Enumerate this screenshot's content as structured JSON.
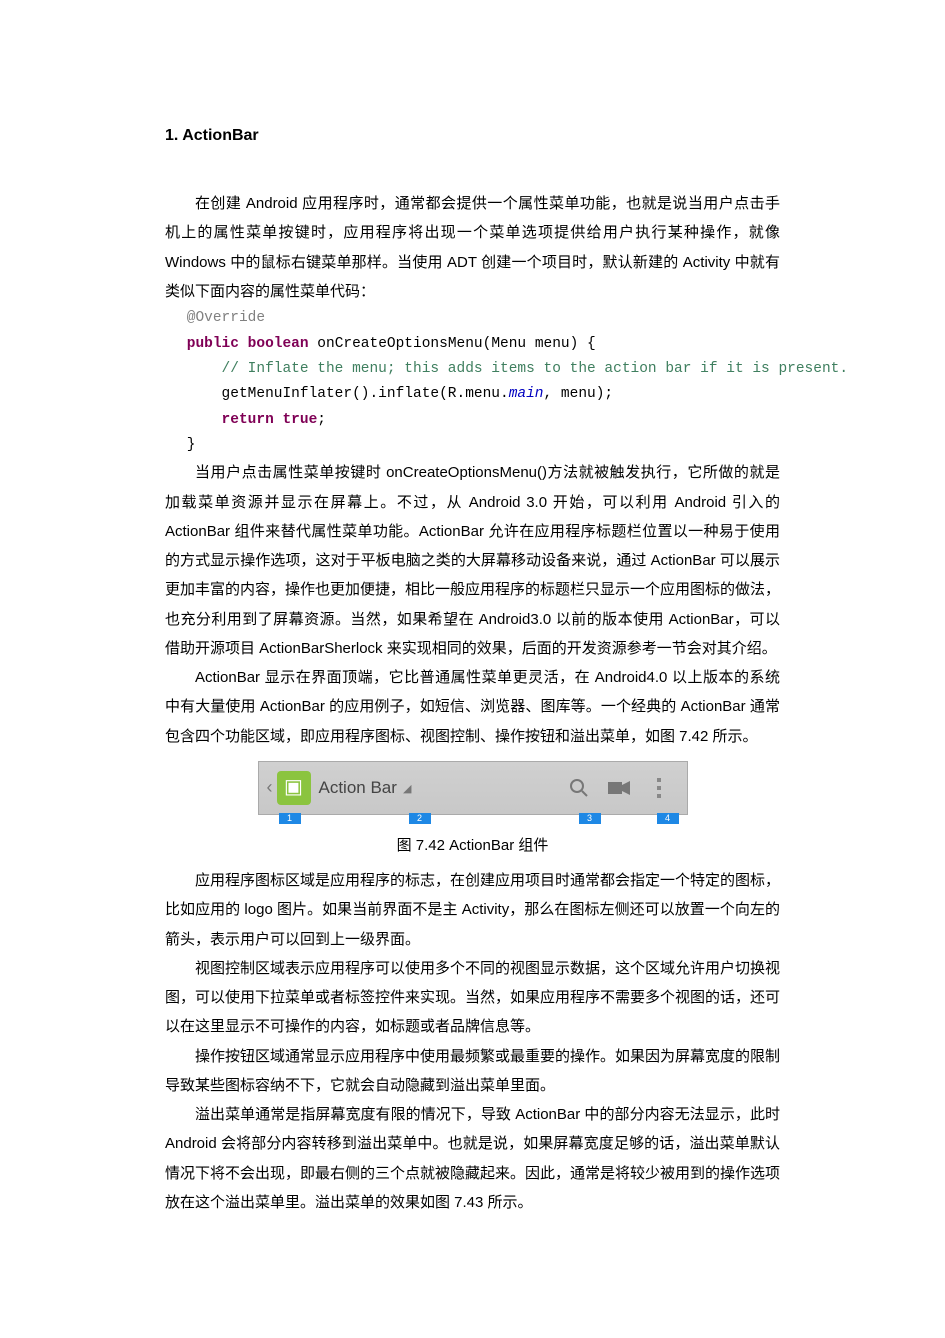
{
  "heading": "1. ActionBar",
  "para1": "在创建 Android 应用程序时，通常都会提供一个属性菜单功能，也就是说当用户点击手机上的属性菜单按键时，应用程序将出现一个菜单选项提供给用户执行某种操作，就像 Windows 中的鼠标右键菜单那样。当使用 ADT 创建一个项目时，默认新建的 Activity 中就有类似下面内容的属性菜单代码：",
  "code": {
    "l1a": "@Override",
    "l2a": "public",
    "l2b": " ",
    "l2c": "boolean",
    "l2d": " onCreateOptionsMenu(Menu menu) {",
    "l3": "    // Inflate the menu; this adds items to the action bar if it is present.",
    "l4a": "    getMenuInflater().inflate(R.menu.",
    "l4b": "main",
    "l4c": ", menu);",
    "l5": "    return true",
    "l5b": ";",
    "l6": "}"
  },
  "para2": "当用户点击属性菜单按键时 onCreateOptionsMenu()方法就被触发执行，它所做的就是加载菜单资源并显示在屏幕上。不过，从 Android 3.0 开始，可以利用 Android 引入的 ActionBar 组件来替代属性菜单功能。ActionBar  允许在应用程序标题栏位置以一种易于使用的方式显示操作选项，这对于平板电脑之类的大屏幕移动设备来说，通过 ActionBar 可以展示更加丰富的内容，操作也更加便捷，相比一般应用程序的标题栏只显示一个应用图标的做法，也充分利用到了屏幕资源。当然，如果希望在 Android3.0 以前的版本使用 ActionBar，可以借助开源项目 ActionBarSherlock 来实现相同的效果，后面的开发资源参考一节会对其介绍。",
  "para3": "ActionBar 显示在界面顶端，它比普通属性菜单更灵活，在 Android4.0 以上版本的系统中有大量使用 ActionBar 的应用例子，如短信、浏览器、图库等。一个经典的 ActionBar 通常包含四个功能区域，即应用程序图标、视图控制、操作按钮和溢出菜单，如图 7.42 所示。",
  "figure": {
    "title": "Action Bar",
    "n1": "1",
    "n2": "2",
    "n3": "3",
    "n4": "4"
  },
  "caption": "图 7.42 ActionBar 组件",
  "para4": "应用程序图标区域是应用程序的标志，在创建应用项目时通常都会指定一个特定的图标，比如应用的 logo 图片。如果当前界面不是主 Activity，那么在图标左侧还可以放置一个向左的箭头，表示用户可以回到上一级界面。",
  "para5": "视图控制区域表示应用程序可以使用多个不同的视图显示数据，这个区域允许用户切换视图，可以使用下拉菜单或者标签控件来实现。当然，如果应用程序不需要多个视图的话，还可以在这里显示不可操作的内容，如标题或者品牌信息等。",
  "para6": "操作按钮区域通常显示应用程序中使用最频繁或最重要的操作。如果因为屏幕宽度的限制导致某些图标容纳不下，它就会自动隐藏到溢出菜单里面。",
  "para7": "溢出菜单通常是指屏幕宽度有限的情况下，导致 ActionBar 中的部分内容无法显示，此时 Android 会将部分内容转移到溢出菜单中。也就是说，如果屏幕宽度足够的话，溢出菜单默认情况下将不会出现，即最右侧的三个点就被隐藏起来。因此，通常是将较少被用到的操作选项放在这个溢出菜单里。溢出菜单的效果如图 7.43 所示。"
}
